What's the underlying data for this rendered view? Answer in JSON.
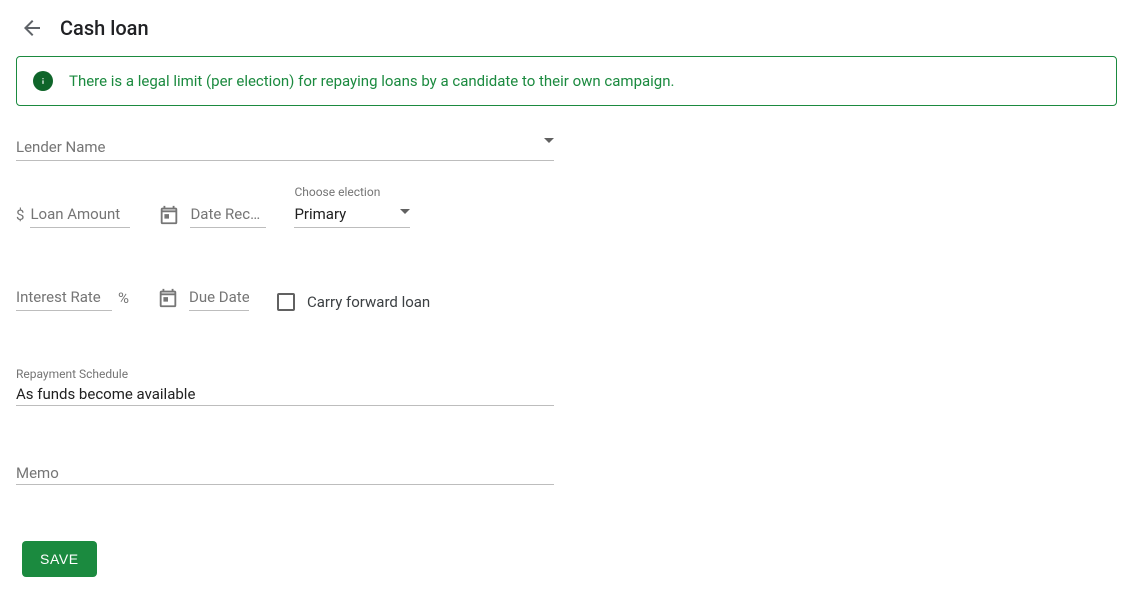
{
  "header": {
    "title": "Cash loan"
  },
  "banner": {
    "text": "There is a legal limit (per election) for repaying loans by a candidate to their own campaign."
  },
  "lender": {
    "placeholder": "Lender Name",
    "value": ""
  },
  "loan_amount": {
    "prefix": "$",
    "placeholder": "Loan Amount",
    "value": ""
  },
  "date_received": {
    "placeholder": "Date Rec…",
    "value": ""
  },
  "election": {
    "label": "Choose election",
    "selected": "Primary"
  },
  "interest_rate": {
    "placeholder": "Interest Rate",
    "suffix": "%",
    "value": ""
  },
  "due_date": {
    "placeholder": "Due Date",
    "value": ""
  },
  "carry_forward": {
    "label": "Carry forward loan",
    "checked": false
  },
  "repayment": {
    "label": "Repayment Schedule",
    "value": "As funds become available"
  },
  "memo": {
    "placeholder": "Memo",
    "value": ""
  },
  "actions": {
    "save": "SAVE"
  }
}
